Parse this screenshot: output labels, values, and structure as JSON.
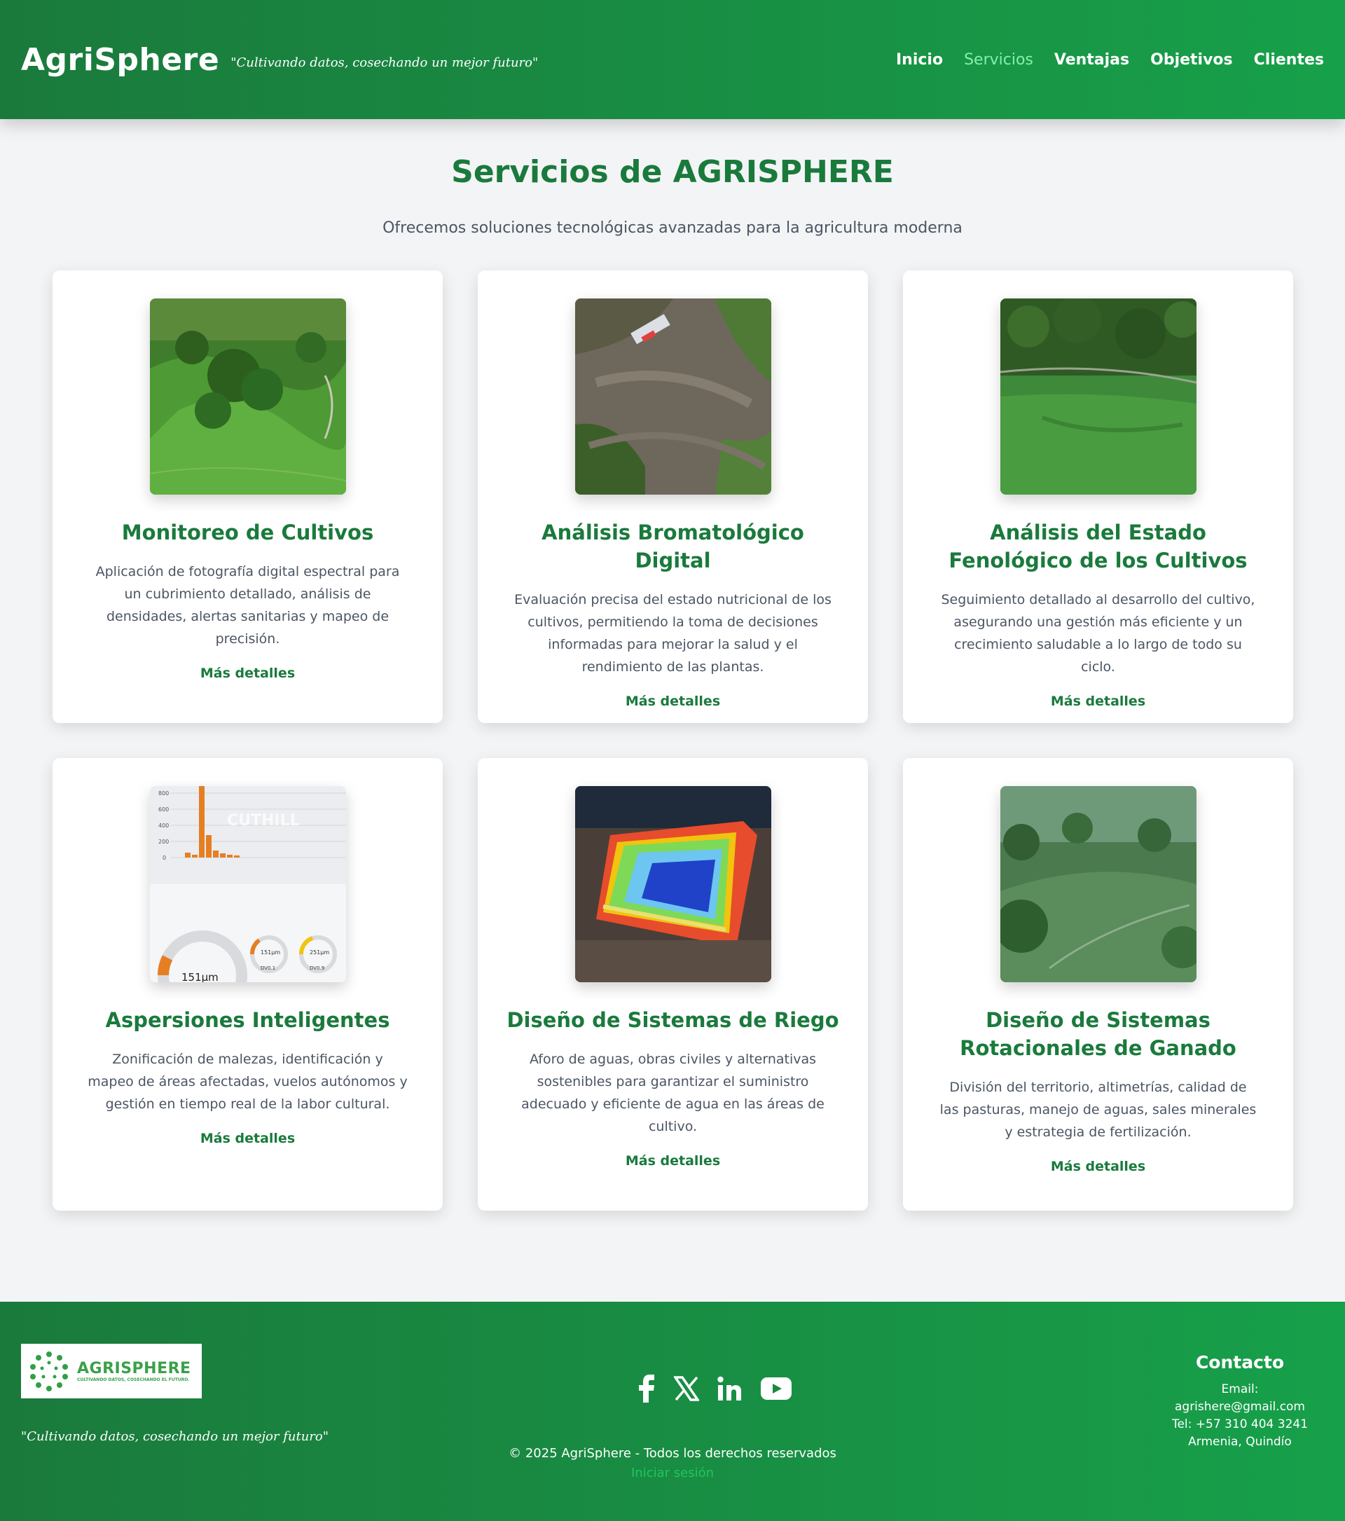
{
  "header": {
    "brand": "AgriSphere",
    "tagline": "\"Cultivando datos, cosechando un mejor futuro\"",
    "nav": [
      {
        "label": "Inicio",
        "active": false
      },
      {
        "label": "Servicios",
        "active": true
      },
      {
        "label": "Ventajas",
        "active": false
      },
      {
        "label": "Objetivos",
        "active": false
      },
      {
        "label": "Clientes",
        "active": false
      }
    ]
  },
  "main": {
    "title": "Servicios de AGRISPHERE",
    "subtitle": "Ofrecemos soluciones tecnológicas avanzadas para la agricultura moderna",
    "cards": [
      {
        "title": "Monitoreo de Cultivos",
        "desc": "Aplicación de fotografía digital espectral para un cubrimiento detallado, análisis de densidades, alertas sanitarias y mapeo de precisión.",
        "link": "Más detalles",
        "image": "aerial-green-hills-photo"
      },
      {
        "title": "Análisis Bromatológico Digital",
        "desc": "Evaluación precisa del estado nutricional de los cultivos, permitiendo la toma de decisiones informadas para mejorar la salud y el rendimiento de las plantas.",
        "link": "Más detalles",
        "image": "aerial-bare-field-photo"
      },
      {
        "title": "Análisis del Estado Fenológico de los Cultivos",
        "desc": "Seguimiento detallado al desarrollo del cultivo, asegurando una gestión más eficiente y un crecimiento saludable a lo largo de todo su ciclo.",
        "link": "Más detalles",
        "image": "aerial-crop-field-photo"
      },
      {
        "title": "Aspersiones Inteligentes",
        "desc": "Zonificación de malezas, identificación y mapeo de áreas afectadas, vuelos autónomos y gestión en tiempo real de la labor cultural.",
        "link": "Más detalles",
        "image": "droplet-histogram-screenshot",
        "image_text": {
          "watermark": "CUTHILL",
          "gauge_main": "151µm",
          "gauge_a": "151µm",
          "gauge_a_label": "DV0.1",
          "gauge_b": "251µm",
          "gauge_b_label": "DV0.9",
          "y_ticks": [
            "800",
            "600",
            "400",
            "200",
            "0"
          ]
        }
      },
      {
        "title": "Diseño de Sistemas de Riego",
        "desc": "Aforo de aguas, obras civiles y alternativas sostenibles para garantizar el suministro adecuado y eficiente de agua en las áreas de cultivo.",
        "link": "Más detalles",
        "image": "irrigation-heatmap-photo"
      },
      {
        "title": "Diseño de Sistemas Rotacionales de Ganado",
        "desc": "División del territorio, altimetrías, calidad de las pasturas, manejo de aguas, sales minerales y estrategia de fertilización.",
        "link": "Más detalles",
        "image": "pasture-valley-photo"
      }
    ]
  },
  "footer": {
    "logo_word": "AGRISPHERE",
    "logo_sub": "CULTIVANDO DATOS, COSECHANDO EL FUTURO.",
    "tagline": "\"Cultivando datos, cosechando un mejor futuro\"",
    "socials": [
      "facebook-icon",
      "x-icon",
      "linkedin-icon",
      "youtube-icon"
    ],
    "copyright": "© 2025 AgriSphere - Todos los derechos reservados",
    "login": "Iniciar sesión",
    "contact": {
      "title": "Contacto",
      "email": "Email: agrishere@gmail.com",
      "phone": "Tel: +57 310 404 3241",
      "city": "Armenia, Quindío"
    }
  },
  "colors": {
    "primary": "#1a7a3c",
    "header_gradient_end": "#17a04a",
    "active_nav": "#86efac",
    "login_link": "#22c55e"
  }
}
